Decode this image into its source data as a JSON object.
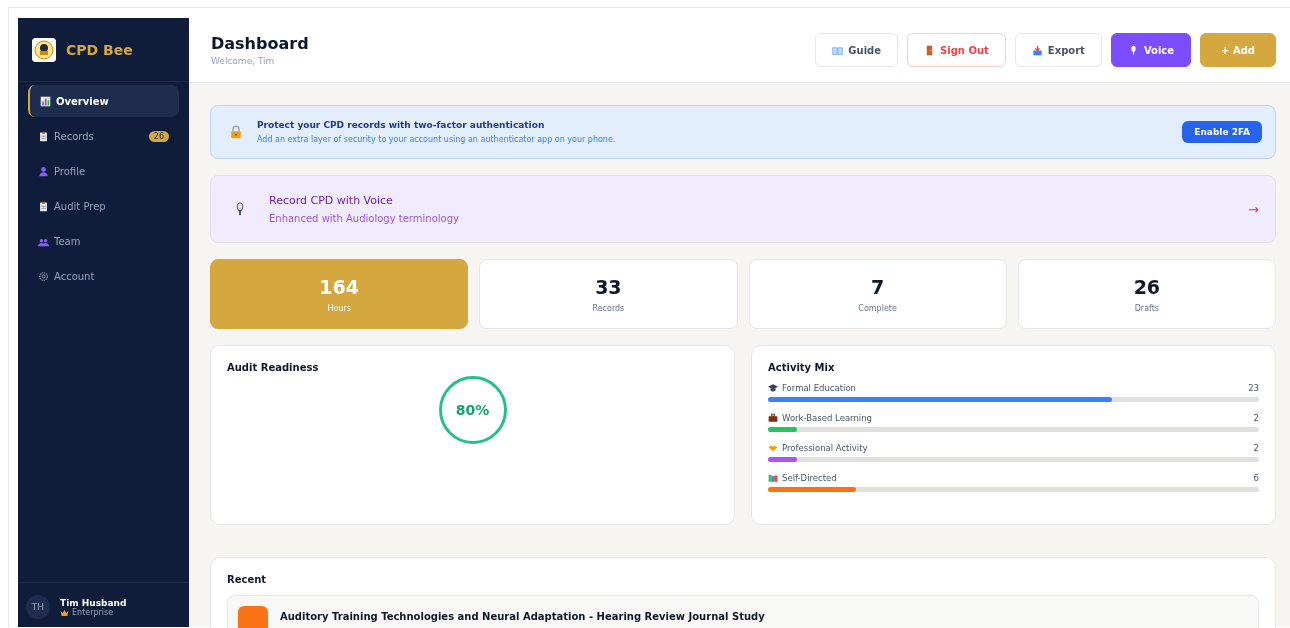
{
  "sidebar": {
    "brand": "CPD Bee",
    "items": [
      {
        "label": "Overview",
        "kind": "chart",
        "selected": true
      },
      {
        "label": "Records",
        "kind": "clipboard",
        "selected": false,
        "badge": "26"
      },
      {
        "label": "Profile",
        "kind": "person",
        "selected": false
      },
      {
        "label": "Audit Prep",
        "kind": "clipboard",
        "selected": false
      },
      {
        "label": "Team",
        "kind": "people",
        "selected": false
      },
      {
        "label": "Account",
        "kind": "gear",
        "selected": false
      }
    ],
    "user": {
      "initials": "TH",
      "name": "Tim Husband",
      "plan": "Enterprise"
    }
  },
  "header": {
    "title": "Dashboard",
    "subtitle": "Welcome, Tim",
    "buttons": [
      {
        "label": "Guide",
        "kind": "plain"
      },
      {
        "label": "Sign Out",
        "kind": "danger"
      },
      {
        "label": "Export",
        "kind": "plain"
      },
      {
        "label": "Voice",
        "kind": "voice"
      },
      {
        "label": "+ Add",
        "kind": "primary"
      }
    ]
  },
  "security_banner": {
    "title": "Protect your CPD records with two-factor authentication",
    "text": "Add an extra layer of security to your account using an authenticator app on your phone.",
    "button": "Enable 2FA"
  },
  "voice_banner": {
    "title": "Record CPD with Voice",
    "text": "Enhanced with Audiology terminology",
    "arrow": "→"
  },
  "stats": [
    {
      "value": "164",
      "label": "Hours",
      "selected": true
    },
    {
      "value": "33",
      "label": "Records",
      "selected": false
    },
    {
      "value": "7",
      "label": "Complete",
      "selected": false
    },
    {
      "value": "26",
      "label": "Drafts",
      "selected": false
    }
  ],
  "audit": {
    "title": "Audit Readiness",
    "value": "80%"
  },
  "activity": {
    "title": "Activity Mix",
    "items": [
      {
        "label": "Formal Education",
        "kind": "cap",
        "count": "23",
        "level": 0.7,
        "color": "#3b82f6"
      },
      {
        "label": "Work-Based Learning",
        "kind": "briefcase",
        "count": "2",
        "level": 0.06,
        "color": "#22c55e"
      },
      {
        "label": "Professional Activity",
        "kind": "handshake",
        "count": "2",
        "level": 0.06,
        "color": "#a855f7"
      },
      {
        "label": "Self-Directed",
        "kind": "books",
        "count": "6",
        "level": 0.18,
        "color": "#f97316"
      }
    ]
  },
  "recent": {
    "title": "Recent",
    "items": [
      {
        "title": "Auditory Training Technologies and Neural Adaptation - Hearing Review Journal Study"
      }
    ]
  }
}
